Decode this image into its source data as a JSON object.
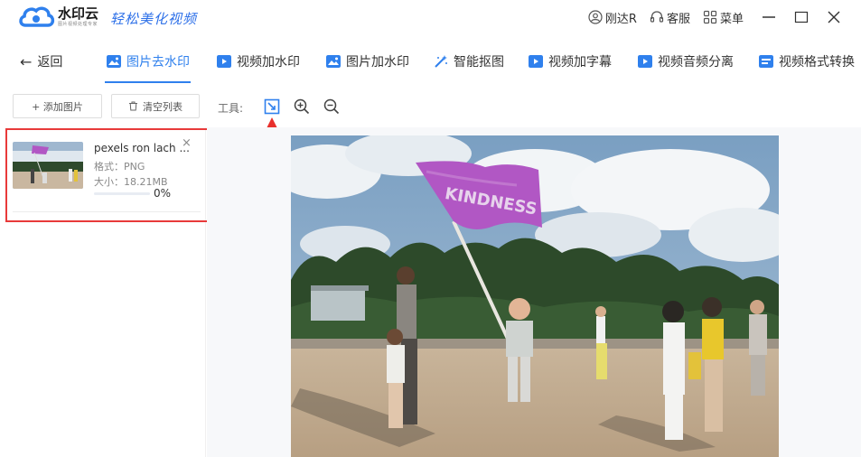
{
  "app": {
    "logo_name": "水印云",
    "logo_sub": "图片视频处理专家",
    "slogan": "轻松美化视频"
  },
  "titlebar": {
    "user": "刚达R",
    "service": "客服",
    "menu": "菜单"
  },
  "nav": {
    "back": "返回",
    "tabs": [
      {
        "label": "图片去水印",
        "icon": "image-icon",
        "active": true
      },
      {
        "label": "视频加水印",
        "icon": "video-icon",
        "active": false
      },
      {
        "label": "图片加水印",
        "icon": "image-icon",
        "active": false
      },
      {
        "label": "智能抠图",
        "icon": "magic-wand-icon",
        "active": false
      },
      {
        "label": "视频加字幕",
        "icon": "video-icon",
        "active": false
      },
      {
        "label": "视频音频分离",
        "icon": "video-icon",
        "active": false
      },
      {
        "label": "视频格式转换",
        "icon": "format-icon",
        "active": false
      }
    ]
  },
  "toolbar": {
    "add_image": "+ 添加图片",
    "clear_list": "清空列表",
    "tools_label": "工具:"
  },
  "file": {
    "name": "pexels ron lach ...",
    "format": "格式：PNG",
    "size": "大小：18.21MB",
    "progress_text": "0%",
    "progress": 0
  },
  "photo": {
    "flag_text": "KINDNESS"
  },
  "colors": {
    "accent": "#2f80ed",
    "highlight": "#e83a3a",
    "flag": "#b157c4"
  }
}
